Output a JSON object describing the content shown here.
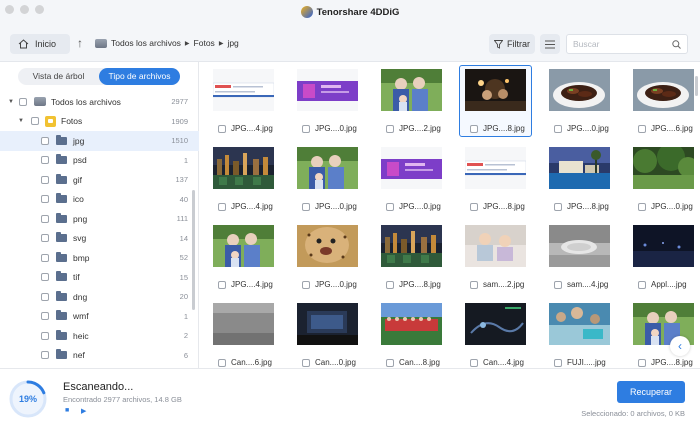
{
  "app": {
    "title": "Tenorshare 4DDiG"
  },
  "toolbar": {
    "home_label": "Inicio",
    "breadcrumb": [
      "Todos los archivos",
      "Fotos",
      "jpg"
    ],
    "filter_label": "Filtrar",
    "search_placeholder": "Buscar"
  },
  "sidebar": {
    "tabs": [
      "Vista de árbol",
      "Tipo de archivos"
    ],
    "active_tab": 1,
    "tree": [
      {
        "label": "Todos los archivos",
        "count": "2977",
        "level": 0,
        "icon": "drive-icon"
      },
      {
        "label": "Fotos",
        "count": "1909",
        "level": 1,
        "icon": "photo-folder-icon"
      },
      {
        "label": "jpg",
        "count": "1510",
        "level": 2,
        "icon": "folder-icon",
        "selected": true
      },
      {
        "label": "psd",
        "count": "1",
        "level": 2,
        "icon": "folder-icon"
      },
      {
        "label": "gif",
        "count": "137",
        "level": 2,
        "icon": "folder-icon"
      },
      {
        "label": "ico",
        "count": "40",
        "level": 2,
        "icon": "folder-icon"
      },
      {
        "label": "png",
        "count": "111",
        "level": 2,
        "icon": "folder-icon"
      },
      {
        "label": "svg",
        "count": "14",
        "level": 2,
        "icon": "folder-icon"
      },
      {
        "label": "bmp",
        "count": "52",
        "level": 2,
        "icon": "folder-icon"
      },
      {
        "label": "tif",
        "count": "15",
        "level": 2,
        "icon": "folder-icon"
      },
      {
        "label": "dng",
        "count": "20",
        "level": 2,
        "icon": "folder-icon"
      },
      {
        "label": "wmf",
        "count": "1",
        "level": 2,
        "icon": "folder-icon"
      },
      {
        "label": "heic",
        "count": "2",
        "level": 2,
        "icon": "folder-icon"
      },
      {
        "label": "nef",
        "count": "6",
        "level": 2,
        "icon": "folder-icon"
      }
    ]
  },
  "grid": {
    "rows": [
      [
        {
          "name": "JPG....4.jpg",
          "thumb": "web"
        },
        {
          "name": "JPG....0.jpg",
          "thumb": "purple"
        },
        {
          "name": "JPG....2.jpg",
          "thumb": "elders"
        },
        {
          "name": "JPG....8.jpg",
          "thumb": "night",
          "selected": true
        },
        {
          "name": "JPG....0.jpg",
          "thumb": "food"
        },
        {
          "name": "JPG....6.jpg",
          "thumb": "food"
        }
      ],
      [
        {
          "name": "JPG....4.jpg",
          "thumb": "city"
        },
        {
          "name": "JPG....0.jpg",
          "thumb": "elders"
        },
        {
          "name": "JPG....0.jpg",
          "thumb": "purple"
        },
        {
          "name": "JPG....8.jpg",
          "thumb": "web"
        },
        {
          "name": "JPG....8.jpg",
          "thumb": "resort"
        },
        {
          "name": "JPG....0.jpg",
          "thumb": "forest"
        }
      ],
      [
        {
          "name": "JPG....4.jpg",
          "thumb": "elders"
        },
        {
          "name": "JPG....0.jpg",
          "thumb": "cheetah"
        },
        {
          "name": "JPG....8.jpg",
          "thumb": "city"
        },
        {
          "name": "sam....2.jpg",
          "thumb": "kids"
        },
        {
          "name": "sam....4.jpg",
          "thumb": "sink"
        },
        {
          "name": "Appl....jpg",
          "thumb": "dark"
        }
      ],
      [
        {
          "name": "Can....6.jpg",
          "thumb": "gray"
        },
        {
          "name": "Can....0.jpg",
          "thumb": "dark2"
        },
        {
          "name": "Can....8.jpg",
          "thumb": "team"
        },
        {
          "name": "Can....4.jpg",
          "thumb": "dark3"
        },
        {
          "name": "FUJI.....jpg",
          "thumb": "crowd"
        },
        {
          "name": "JPG....8.jpg",
          "thumb": "elders"
        }
      ]
    ]
  },
  "status": {
    "progress_pct": 19,
    "progress_label": "19%",
    "title": "Escaneando...",
    "subtitle": "Encontrado 2977 archivos, 14.8 GB",
    "recover_label": "Recuperar",
    "selected_info": "Seleccionado: 0 archivos, 0 KB"
  },
  "colors": {
    "accent": "#2e7de1",
    "sidebar_selected": "#e8f0fc"
  }
}
